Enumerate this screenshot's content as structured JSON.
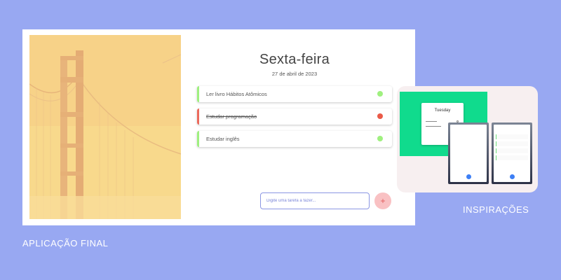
{
  "app": {
    "day_title": "Sexta-feira",
    "date": "27 de abril de 2023",
    "tasks": [
      {
        "label": "Ler livro Hábitos Atômicos",
        "status": "pending",
        "accent": "#9ff07f"
      },
      {
        "label": "Estudar programação",
        "status": "done",
        "accent": "#ec6a5c"
      },
      {
        "label": "Estudar inglês",
        "status": "pending",
        "accent": "#9ff07f"
      }
    ],
    "input_placeholder": "Digite uma tarefa a fazer...",
    "add_symbol": "+"
  },
  "inspiration": {
    "card_title": "Tuesday"
  },
  "labels": {
    "final": "APLICAÇÃO FINAL",
    "inspirations": "INSPIRAÇÕES"
  },
  "colors": {
    "background": "#98a8f2",
    "green_accent": "#9ff07f",
    "red_accent": "#ec6a5c",
    "inspiration_green": "#10db8d"
  },
  "icons": {
    "photo": "golden-gate-bridge-image",
    "add": "plus-icon",
    "status": "status-dot-icon"
  }
}
